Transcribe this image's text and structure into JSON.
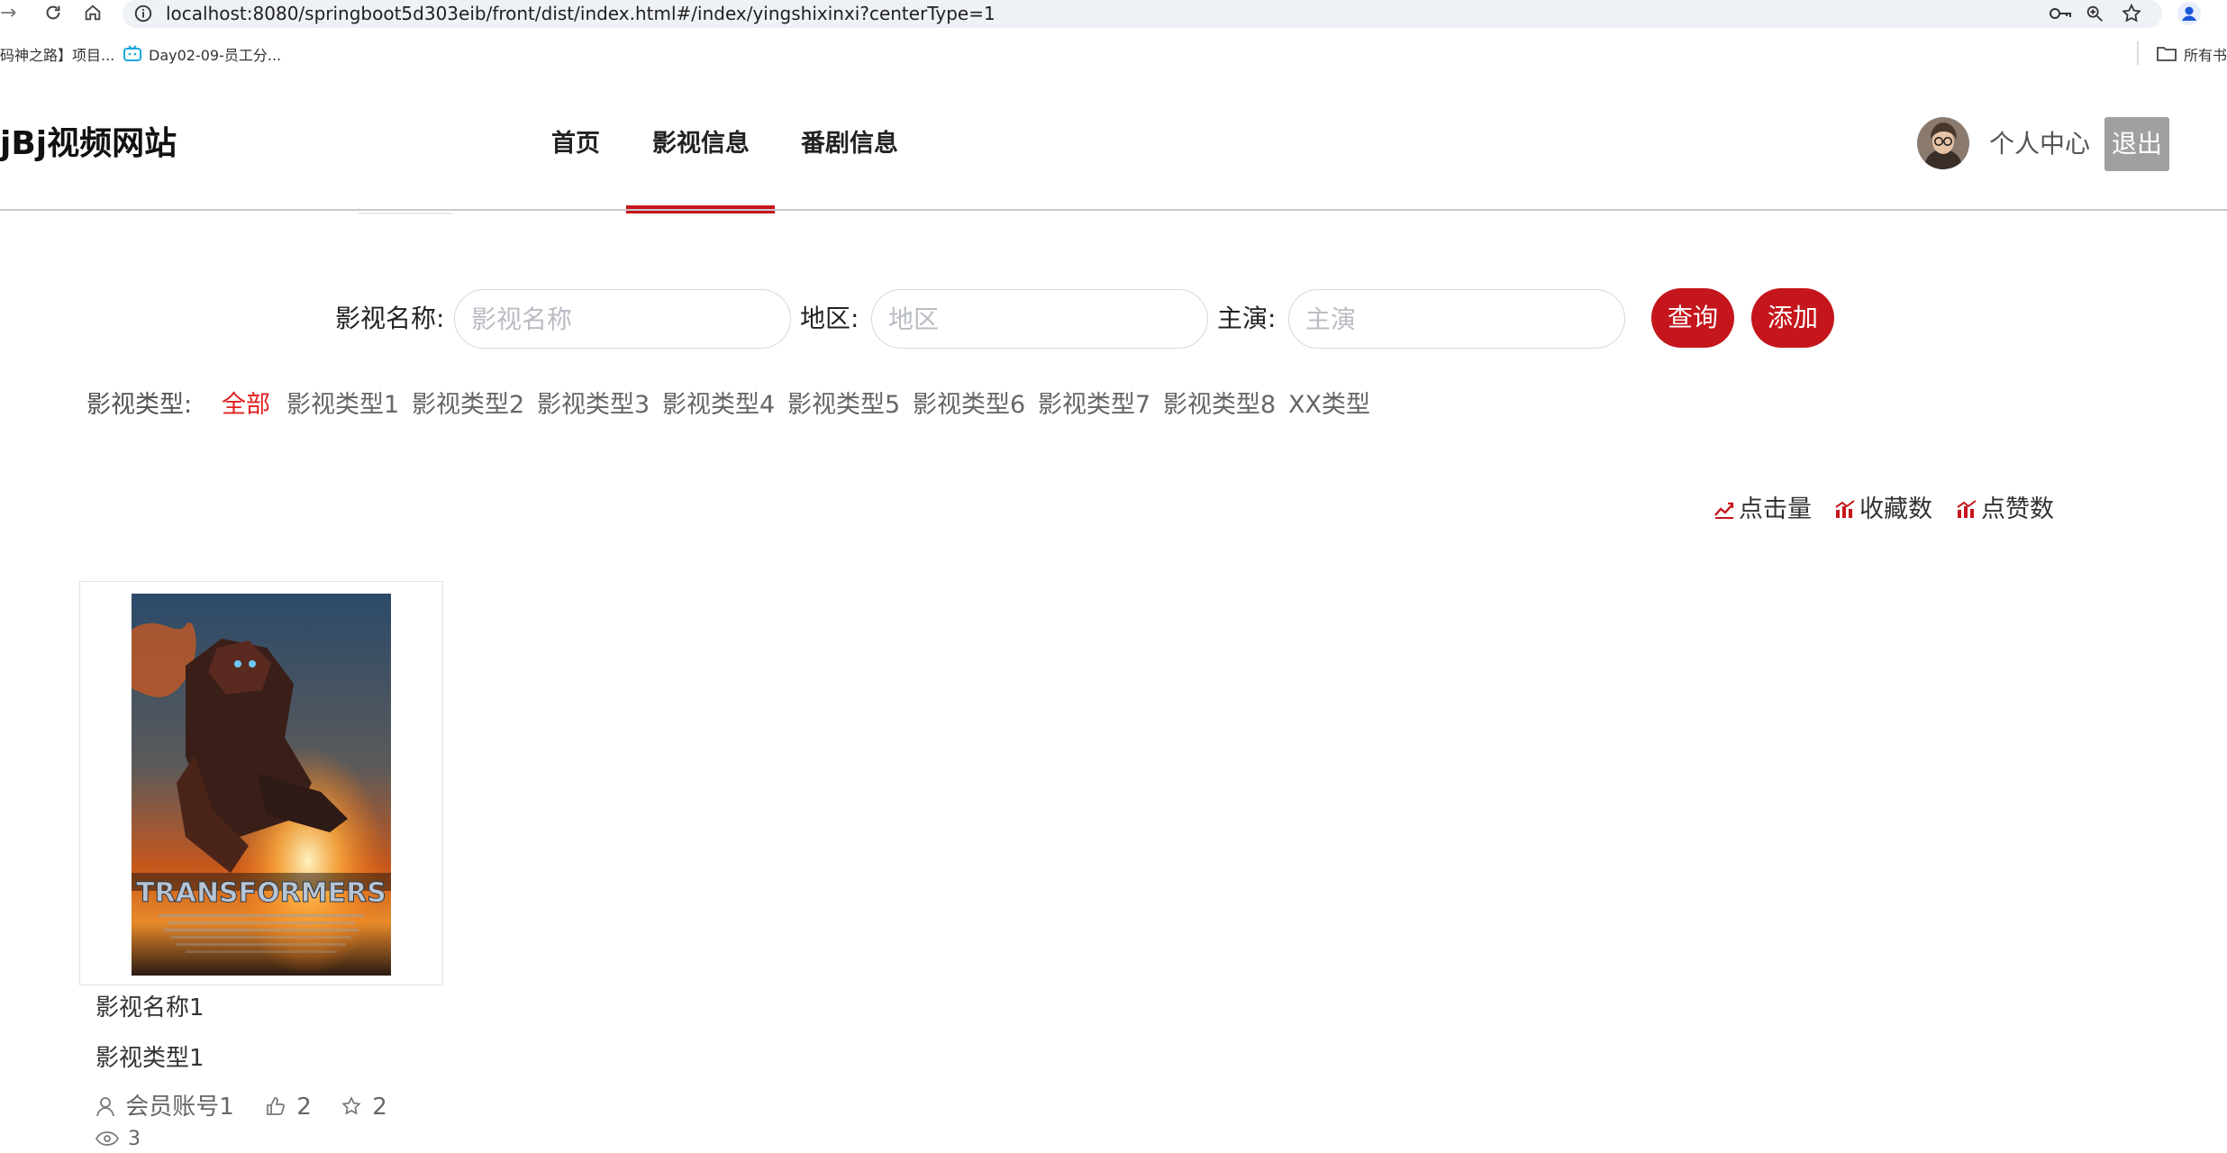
{
  "browser": {
    "url": "localhost:8080/springboot5d303eib/front/dist/index.html#/index/yingshixinxi?centerType=1",
    "bookmarks": [
      "码神之路】项目...",
      "Day02-09-员工分...",
      "所有书"
    ]
  },
  "header": {
    "brand": "jBj视频网站",
    "nav": [
      "首页",
      "影视信息",
      "番剧信息"
    ],
    "active_nav": "影视信息",
    "user_center": "个人中心",
    "logout": "退出"
  },
  "search": {
    "name_label": "影视名称:",
    "name_placeholder": "影视名称",
    "region_label": "地区:",
    "region_placeholder": "地区",
    "actor_label": "主演:",
    "actor_placeholder": "主演",
    "query_button": "查询",
    "add_button": "添加"
  },
  "categories": {
    "label": "影视类型:",
    "items": [
      "全部",
      "影视类型1",
      "影视类型2",
      "影视类型3",
      "影视类型4",
      "影视类型5",
      "影视类型6",
      "影视类型7",
      "影视类型8",
      "XX类型"
    ],
    "active": "全部"
  },
  "sort": {
    "items": [
      "点击量",
      "收藏数",
      "点赞数"
    ]
  },
  "cards": [
    {
      "poster_text": "TRANSFORMERS",
      "title": "影视名称1",
      "type": "影视类型1",
      "account": "会员账号1",
      "likes": "2",
      "favorites": "2",
      "views": "3"
    }
  ],
  "colors": {
    "accent": "#c4161c",
    "active_text": "#e02020",
    "logout_bg": "#a0a0a0"
  }
}
